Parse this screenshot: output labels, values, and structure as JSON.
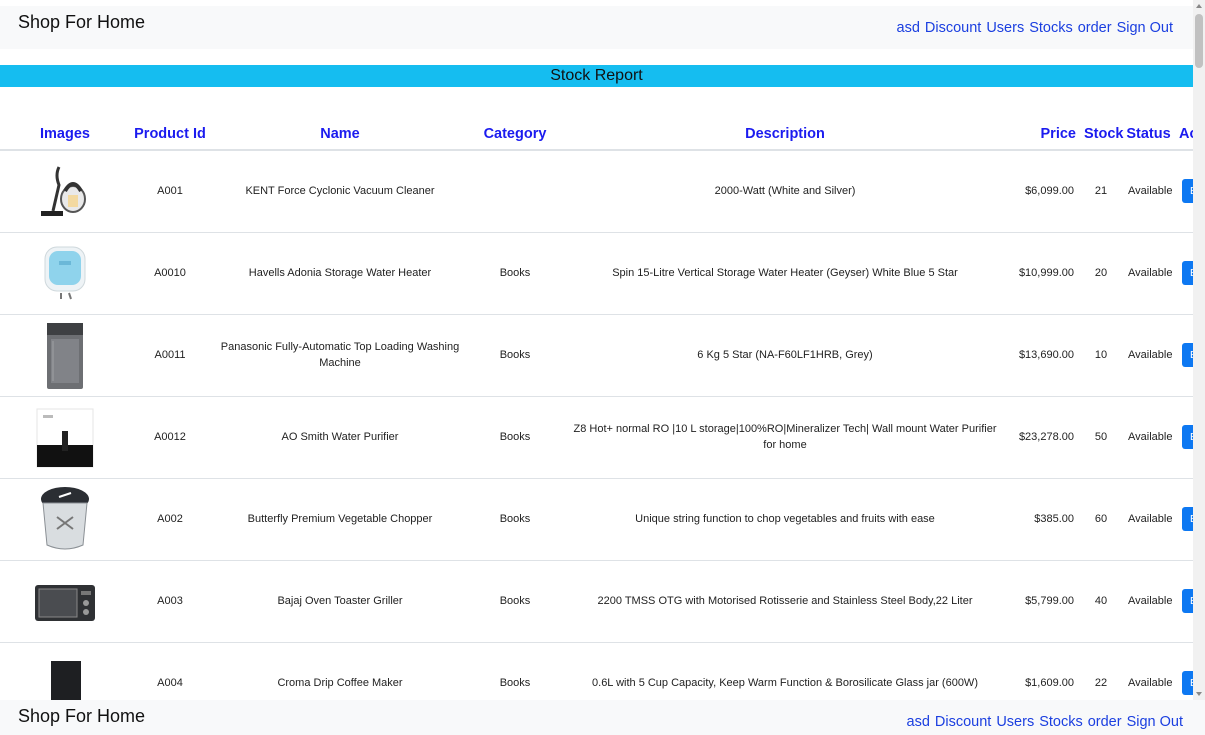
{
  "navbar": {
    "brand": "Shop For Home",
    "links": [
      "asd",
      "Discount",
      "Users",
      "Stocks",
      "order",
      "Sign Out"
    ]
  },
  "report": {
    "title": "Stock Report"
  },
  "table": {
    "headers": [
      "Images",
      "Product Id",
      "Name",
      "Category",
      "Description",
      "Price",
      "Stock",
      "Status",
      "Action"
    ],
    "rows": [
      {
        "icon": "vacuum-cleaner-image",
        "id": "A001",
        "name": "KENT Force Cyclonic Vacuum Cleaner",
        "category": "",
        "description": "2000-Watt (White and Silver)",
        "price": "$6,099.00",
        "stock": "21",
        "status": "Available",
        "action": "Edit"
      },
      {
        "icon": "water-heater-image",
        "id": "A0010",
        "name": "Havells Adonia Storage Water Heater",
        "category": "Books",
        "description": "Spin 15-Litre Vertical Storage Water Heater (Geyser) White Blue 5 Star",
        "price": "$10,999.00",
        "stock": "20",
        "status": "Available",
        "action": "Edit"
      },
      {
        "icon": "washing-machine-image",
        "id": "A0011",
        "name": "Panasonic Fully-Automatic Top Loading Washing Machine",
        "category": "Books",
        "description": "6 Kg 5 Star (NA-F60LF1HRB, Grey)",
        "price": "$13,690.00",
        "stock": "10",
        "status": "Available",
        "action": "Edit"
      },
      {
        "icon": "water-purifier-image",
        "id": "A0012",
        "name": "AO Smith Water Purifier",
        "category": "Books",
        "description": "Z8 Hot+ normal RO |10 L storage|100%RO|Mineralizer Tech| Wall mount Water Purifier for home",
        "price": "$23,278.00",
        "stock": "50",
        "status": "Available",
        "action": "Edit"
      },
      {
        "icon": "vegetable-chopper-image",
        "id": "A002",
        "name": "Butterfly Premium Vegetable Chopper",
        "category": "Books",
        "description": "Unique string function to chop vegetables and fruits with ease",
        "price": "$385.00",
        "stock": "60",
        "status": "Available",
        "action": "Edit"
      },
      {
        "icon": "oven-toaster-image",
        "id": "A003",
        "name": "Bajaj Oven Toaster Griller",
        "category": "Books",
        "description": "2200 TMSS OTG with Motorised Rotisserie and Stainless Steel Body,22 Liter",
        "price": "$5,799.00",
        "stock": "40",
        "status": "Available",
        "action": "Edit"
      },
      {
        "icon": "coffee-maker-image",
        "id": "A004",
        "name": "Croma Drip Coffee Maker",
        "category": "Books",
        "description": "0.6L with 5 Cup Capacity, Keep Warm Function & Borosilicate Glass jar (600W)",
        "price": "$1,609.00",
        "stock": "22",
        "status": "Available",
        "action": "Edit"
      }
    ]
  },
  "footer": {
    "brand": "Shop For Home",
    "links": [
      "asd",
      "Discount",
      "Users",
      "Stocks",
      "order",
      "Sign Out"
    ]
  },
  "colors": {
    "accent": "#15bdf0",
    "link": "#1b3fe0",
    "header_text": "#1b1bef",
    "button": "#0d78f2"
  }
}
